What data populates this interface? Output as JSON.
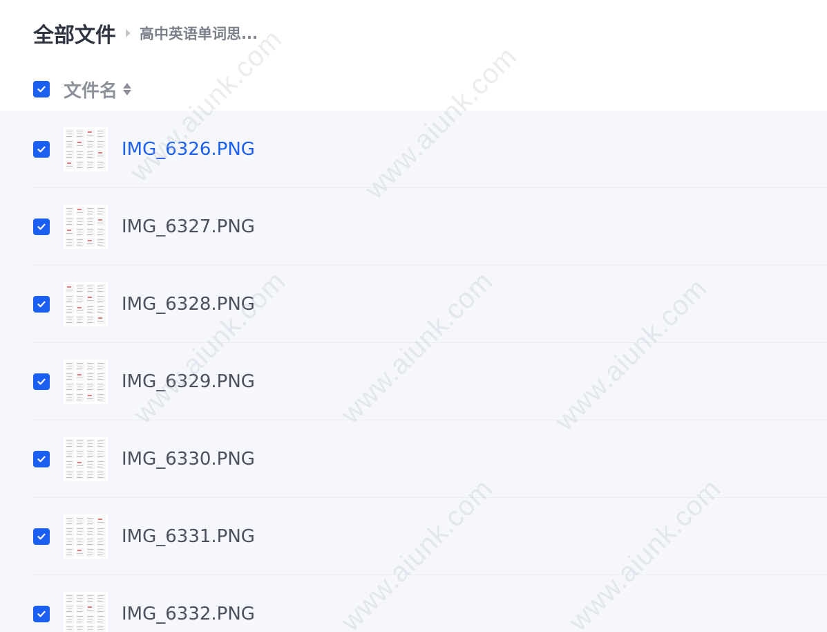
{
  "breadcrumb": {
    "root": "全部文件",
    "current": "高中英语单词思..."
  },
  "list_header": {
    "label": "文件名",
    "select_all_checked": true
  },
  "files": [
    {
      "name": "IMG_6326.PNG",
      "checked": true,
      "active": true
    },
    {
      "name": "IMG_6327.PNG",
      "checked": true,
      "active": false
    },
    {
      "name": "IMG_6328.PNG",
      "checked": true,
      "active": false
    },
    {
      "name": "IMG_6329.PNG",
      "checked": true,
      "active": false
    },
    {
      "name": "IMG_6330.PNG",
      "checked": true,
      "active": false
    },
    {
      "name": "IMG_6331.PNG",
      "checked": true,
      "active": false
    },
    {
      "name": "IMG_6332.PNG",
      "checked": true,
      "active": false
    }
  ],
  "watermark_text": "www.aiunk.com",
  "colors": {
    "accent": "#1a5ff0",
    "list_background": "#f5f7fc",
    "text": "#4b515c"
  }
}
